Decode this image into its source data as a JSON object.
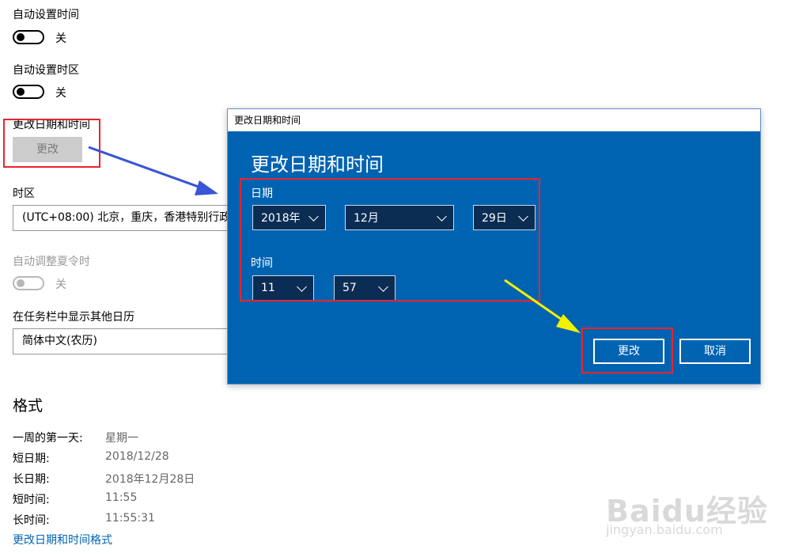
{
  "settings": {
    "auto_time": {
      "label": "自动设置时间",
      "state": "关"
    },
    "auto_timezone": {
      "label": "自动设置时区",
      "state": "关"
    },
    "change_datetime": {
      "label": "更改日期和时间",
      "button": "更改"
    },
    "timezone": {
      "label": "时区",
      "value": "(UTC+08:00) 北京，重庆，香港特别行政区，乌鲁木齐"
    },
    "dst": {
      "label": "自动调整夏令时",
      "state": "关"
    },
    "taskbar_calendar": {
      "label": "在任务栏中显示其他日历",
      "value": "简体中文(农历)"
    }
  },
  "format": {
    "heading": "格式",
    "rows": [
      {
        "key": "一周的第一天:",
        "value": "星期一"
      },
      {
        "key": "短日期:",
        "value": "2018/12/28"
      },
      {
        "key": "长日期:",
        "value": "2018年12月28日"
      },
      {
        "key": "短时间:",
        "value": "11:55"
      },
      {
        "key": "长时间:",
        "value": "11:55:31"
      }
    ],
    "link": "更改日期和时间格式"
  },
  "dialog": {
    "window_title": "更改日期和时间",
    "heading": "更改日期和时间",
    "date_label": "日期",
    "year": "2018年",
    "month": "12月",
    "day": "29日",
    "time_label": "时间",
    "hour": "11",
    "minute": "57",
    "change_button": "更改",
    "cancel_button": "取消"
  },
  "watermark": {
    "brand": "Baidu经验",
    "url": "jingyan.baidu.com"
  },
  "colors": {
    "accent": "#0063b1",
    "highlight_box": "#e8242e",
    "arrow_blue": "#3a55d6",
    "arrow_yellow": "#f2f200"
  }
}
